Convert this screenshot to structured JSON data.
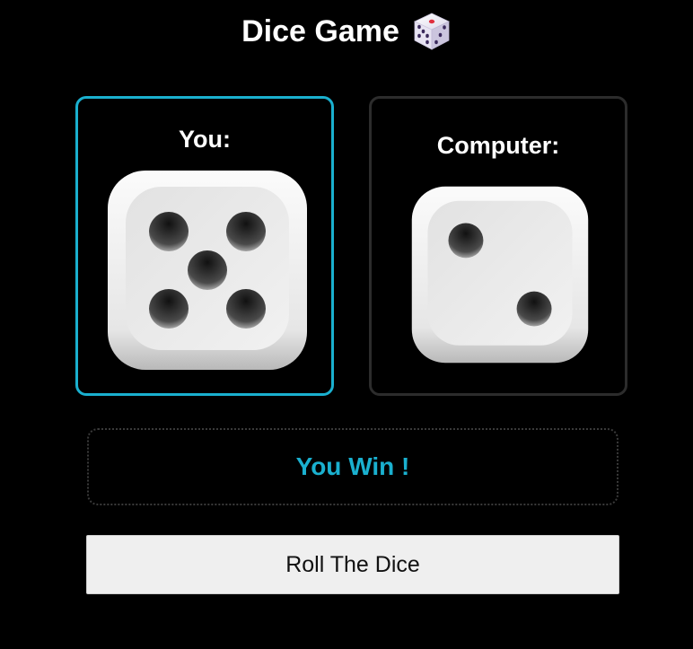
{
  "header": {
    "title": "Dice Game",
    "title_icon": "game-die-icon"
  },
  "players": {
    "you": {
      "label": "You:",
      "die_value": 5,
      "highlighted": true
    },
    "computer": {
      "label": "Computer:",
      "die_value": 2,
      "highlighted": false
    }
  },
  "result": {
    "text": "You Win !"
  },
  "actions": {
    "roll_label": "Roll The Dice"
  },
  "colors": {
    "background": "#000000",
    "accent": "#1ab0cf",
    "inactive_border": "#2c2c2c",
    "button_bg": "#efefef",
    "title_die_pip_red": "#e03040",
    "title_die_pip": "#3b2a5c"
  }
}
